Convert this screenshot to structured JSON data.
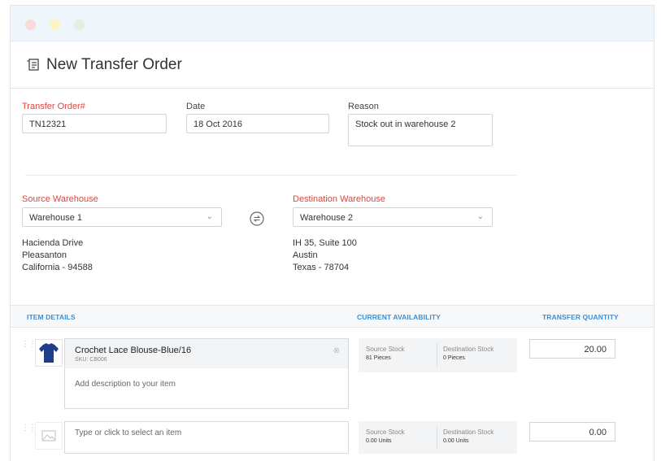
{
  "header": {
    "title": "New Transfer Order",
    "icon": "document-list-icon"
  },
  "form": {
    "transfer_order": {
      "label": "Transfer Order#",
      "value": "TN12321"
    },
    "date": {
      "label": "Date",
      "value": "18 Oct 2016"
    },
    "reason": {
      "label": "Reason",
      "value": "Stock out in warehouse 2"
    },
    "source_warehouse": {
      "label": "Source Warehouse",
      "value": "Warehouse 1",
      "address": [
        "Hacienda Drive",
        "Pleasanton",
        "California - 94588"
      ]
    },
    "destination_warehouse": {
      "label": "Destination Warehouse",
      "value": "Warehouse 2",
      "address": [
        "IH 35, Suite 100",
        "Austin",
        "Texas - 78704"
      ]
    }
  },
  "table": {
    "headers": {
      "item_details": "ITEM DETAILS",
      "current_availability": "CURRENT AVAILABILITY",
      "transfer_quantity": "TRANSFER QUANTITY"
    },
    "rows": [
      {
        "name": "Crochet Lace Blouse-Blue/16",
        "sku": "SKU: CB006",
        "description_placeholder": "Add description to your item",
        "source_stock_label": "Source Stock",
        "source_stock_value": "81 Pieces",
        "destination_stock_label": "Destination Stock",
        "destination_stock_value": "0 Pieces",
        "quantity": "20.00"
      },
      {
        "placeholder": "Type or click to select an item",
        "source_stock_label": "Source Stock",
        "source_stock_value": "0.00 Units",
        "destination_stock_label": "Destination Stock",
        "destination_stock_value": "0.00 Units",
        "quantity": "0.00"
      }
    ]
  },
  "colors": {
    "required_label": "#e0443e",
    "table_header_text": "#3b8fd6",
    "titlebar": "#eef5fb"
  }
}
